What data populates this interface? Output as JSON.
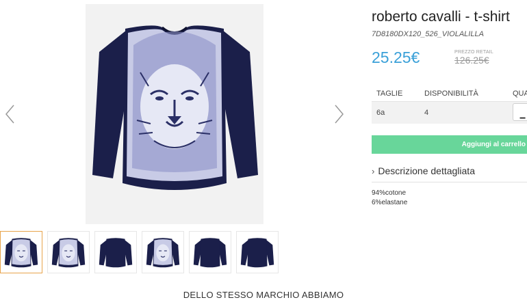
{
  "product": {
    "title": "roberto cavalli - t-shirt",
    "sku": "7D8180DX120_526_VIOLALILLA",
    "price": "25.25€",
    "retail_label": "PREZZO RETAIL",
    "retail_price": "126.25€"
  },
  "sizes_table": {
    "headers": [
      "TAGLIE",
      "DISPONIBILITÀ",
      "QUA"
    ],
    "rows": [
      {
        "size": "6a",
        "availability": "4",
        "qty_button": "−"
      }
    ]
  },
  "cart": {
    "add_label": "Aggiungi al carrello"
  },
  "description": {
    "toggle_label": "Descrizione dettagliata",
    "composition": [
      "94%cotone",
      "6%elastane"
    ]
  },
  "gallery": {
    "prev_icon": "chevron-left-icon",
    "next_icon": "chevron-right-icon",
    "thumbnails": [
      {
        "variant": "lion",
        "active": true
      },
      {
        "variant": "lion",
        "active": false
      },
      {
        "variant": "back",
        "active": false
      },
      {
        "variant": "lion",
        "active": false
      },
      {
        "variant": "back",
        "active": false
      },
      {
        "variant": "back",
        "active": false
      }
    ]
  },
  "brand_section": {
    "heading": "DELLO STESSO MARCHIO ABBIAMO"
  },
  "colors": {
    "price": "#3aa0d8",
    "add_to_cart": "#68d69a",
    "shirt_navy": "#1b1f4a",
    "active_thumb_border": "#e8a34a"
  }
}
